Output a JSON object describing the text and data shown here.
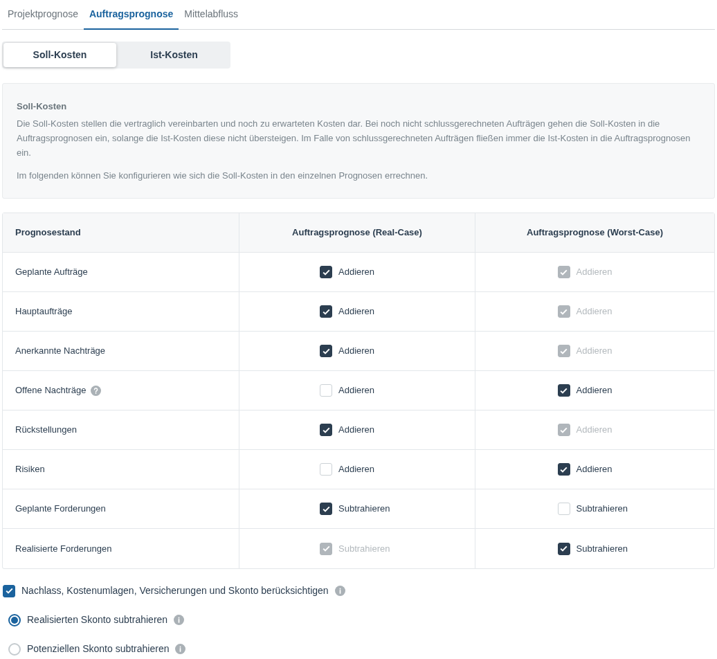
{
  "tabs": [
    {
      "label": "Projektprognose",
      "selected": false
    },
    {
      "label": "Auftragsprognose",
      "selected": true
    },
    {
      "label": "Mittelabfluss",
      "selected": false
    }
  ],
  "segments": [
    {
      "label": "Soll-Kosten",
      "selected": true
    },
    {
      "label": "Ist-Kosten",
      "selected": false
    }
  ],
  "info": {
    "title": "Soll-Kosten",
    "paragraphs": [
      "Die Soll-Kosten stellen die vertraglich vereinbarten und noch zu erwarteten Kosten dar. Bei noch nicht schlussgerechneten Aufträgen gehen die Soll-Kosten in die Auftragsprognosen ein, solange die Ist-Kosten diese nicht übersteigen. Im Falle von schlussgerechneten Aufträgen fließen immer die Ist-Kosten in die Auftragsprognosen ein.",
      "Im folgenden können Sie konfigurieren wie sich die Soll-Kosten in den einzelnen Prognosen errechnen."
    ]
  },
  "table": {
    "columns": [
      "Prognosestand",
      "Auftragsprognose (Real-Case)",
      "Auftragsprognose (Worst-Case)"
    ],
    "rows": [
      {
        "help": false,
        "cells": [
          {
            "kind": "label",
            "text": "Geplante Aufträge"
          },
          {
            "kind": "check",
            "checked": true,
            "disabled": false,
            "text": "Addieren"
          },
          {
            "kind": "check",
            "checked": true,
            "disabled": true,
            "text": "Addieren"
          }
        ]
      },
      {
        "help": false,
        "cells": [
          {
            "kind": "label",
            "text": "Hauptaufträge"
          },
          {
            "kind": "check",
            "checked": true,
            "disabled": false,
            "text": "Addieren"
          },
          {
            "kind": "check",
            "checked": true,
            "disabled": true,
            "text": "Addieren"
          }
        ]
      },
      {
        "help": false,
        "cells": [
          {
            "kind": "label",
            "text": "Anerkannte Nachträge"
          },
          {
            "kind": "check",
            "checked": true,
            "disabled": false,
            "text": "Addieren"
          },
          {
            "kind": "check",
            "checked": true,
            "disabled": true,
            "text": "Addieren"
          }
        ]
      },
      {
        "help": true,
        "cells": [
          {
            "kind": "label",
            "text": "Offene Nachträge"
          },
          {
            "kind": "check",
            "checked": false,
            "disabled": false,
            "text": "Addieren"
          },
          {
            "kind": "check",
            "checked": true,
            "disabled": false,
            "text": "Addieren"
          }
        ]
      },
      {
        "help": false,
        "cells": [
          {
            "kind": "label",
            "text": "Rückstellungen"
          },
          {
            "kind": "check",
            "checked": true,
            "disabled": false,
            "text": "Addieren"
          },
          {
            "kind": "check",
            "checked": true,
            "disabled": true,
            "text": "Addieren"
          }
        ]
      },
      {
        "help": false,
        "cells": [
          {
            "kind": "label",
            "text": "Risiken"
          },
          {
            "kind": "check",
            "checked": false,
            "disabled": false,
            "text": "Addieren"
          },
          {
            "kind": "check",
            "checked": true,
            "disabled": false,
            "text": "Addieren"
          }
        ]
      },
      {
        "help": false,
        "cells": [
          {
            "kind": "label",
            "text": "Geplante Forderungen"
          },
          {
            "kind": "check",
            "checked": true,
            "disabled": false,
            "text": "Subtrahieren"
          },
          {
            "kind": "check",
            "checked": false,
            "disabled": false,
            "text": "Subtrahieren"
          }
        ]
      },
      {
        "help": false,
        "cells": [
          {
            "kind": "label",
            "text": "Realisierte Forderungen"
          },
          {
            "kind": "check",
            "checked": true,
            "disabled": true,
            "text": "Subtrahieren"
          },
          {
            "kind": "check",
            "checked": true,
            "disabled": false,
            "text": "Subtrahieren"
          }
        ]
      }
    ]
  },
  "option": {
    "label": "Nachlass, Kostenumlagen, Versicherungen und Skonto berücksichtigen",
    "checked": true
  },
  "radios": [
    {
      "label": "Realisierten Skonto subtrahieren",
      "selected": true
    },
    {
      "label": "Potenziellen Skonto subtrahieren",
      "selected": false
    }
  ]
}
